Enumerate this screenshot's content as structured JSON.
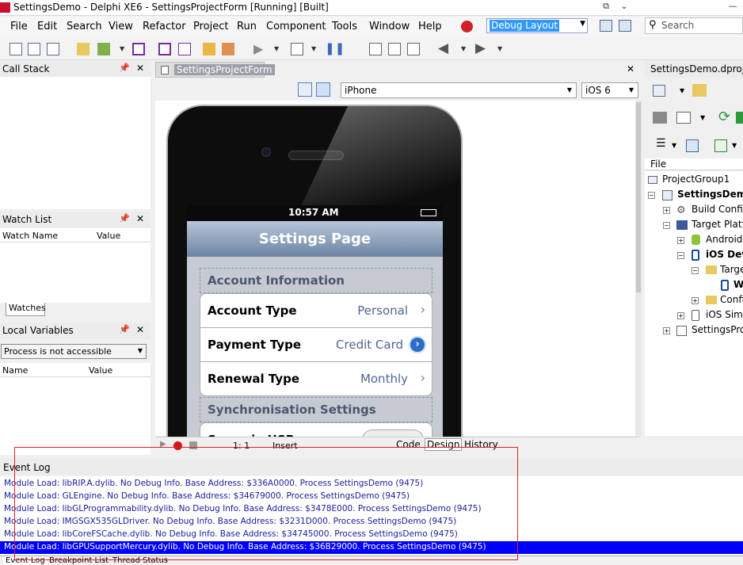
{
  "window": {
    "title": "SettingsDemo - Delphi XE6 - SettingsProjectForm [Running] [Built]"
  },
  "menu": [
    "File",
    "Edit",
    "Search",
    "View",
    "Refactor",
    "Project",
    "Run",
    "Component",
    "Tools",
    "Window",
    "Help"
  ],
  "layout_combo": {
    "value": "Debug Layout"
  },
  "search": {
    "placeholder": "Search"
  },
  "call_stack": {
    "title": "Call Stack"
  },
  "watch_list": {
    "title": "Watch List",
    "col_name": "Watch Name",
    "col_value": "Value",
    "tab": "Watches"
  },
  "local_vars": {
    "title": "Local Variables",
    "process": "Process is not accessible",
    "col_name": "Name",
    "col_value": "Value"
  },
  "editor": {
    "tab": "SettingsProjectForm",
    "device": "iPhone",
    "os": "iOS 6",
    "position": "1:  1",
    "mode": "Insert",
    "bottom_tabs": [
      "Code",
      "Design",
      "History"
    ]
  },
  "phone": {
    "time": "10:57 AM",
    "nav_title": "Settings Page",
    "group1": "Account Information",
    "rows": [
      {
        "label": "Account Type",
        "value": "Personal",
        "accessory": "chevron"
      },
      {
        "label": "Payment Type",
        "value": "Credit Card",
        "accessory": "detail"
      },
      {
        "label": "Renewal Type",
        "value": "Monthly",
        "accessory": "chevron"
      }
    ],
    "group2": "Synchronisation Settings",
    "row4_partial": "Sync via USB"
  },
  "project": {
    "title": "SettingsDemo.dproj",
    "file_label": "File",
    "tree": [
      {
        "label": "ProjectGroup1",
        "indent": 0,
        "bold": false
      },
      {
        "label": "SettingsDemo",
        "indent": 1,
        "bold": true
      },
      {
        "label": "Build Configurations",
        "indent": 2,
        "bold": false
      },
      {
        "label": "Target Platforms",
        "indent": 2,
        "bold": false
      },
      {
        "label": "Android",
        "indent": 3,
        "bold": false
      },
      {
        "label": "iOS Device",
        "indent": 3,
        "bold": true
      },
      {
        "label": "Target",
        "indent": 4,
        "bold": false
      },
      {
        "label": "W",
        "indent": 5,
        "bold": true
      },
      {
        "label": "Configuration",
        "indent": 4,
        "bold": false
      },
      {
        "label": "iOS Simulator",
        "indent": 3,
        "bold": false
      },
      {
        "label": "SettingsProject",
        "indent": 1,
        "bold": false
      }
    ]
  },
  "event_log": {
    "title": "Event Log",
    "lines": [
      "Module Load: libRIP.A.dylib. No Debug Info. Base Address: $336A0000. Process SettingsDemo (9475)",
      "Module Load: GLEngine. No Debug Info. Base Address: $34679000. Process SettingsDemo (9475)",
      "Module Load: libGLProgrammability.dylib. No Debug Info. Base Address: $3478E000. Process SettingsDemo (9475)",
      "Module Load: IMGSGX535GLDriver. No Debug Info. Base Address: $3231D000. Process SettingsDemo (9475)",
      "Module Load: libCoreFSCache.dylib. No Debug Info. Base Address: $34745000. Process SettingsDemo (9475)",
      "Module Load: libGPUSupportMercury.dylib. No Debug Info. Base Address: $36B29000. Process SettingsDemo (9475)"
    ],
    "selected_index": 5,
    "bottom_tabs": [
      "Event Log",
      "Breakpoint List",
      "Thread Status"
    ]
  },
  "colors": {
    "accent": "#3399ff",
    "selection": "#0000ff",
    "log_text": "#1a1aa0",
    "highlight_box": "#e02020"
  }
}
